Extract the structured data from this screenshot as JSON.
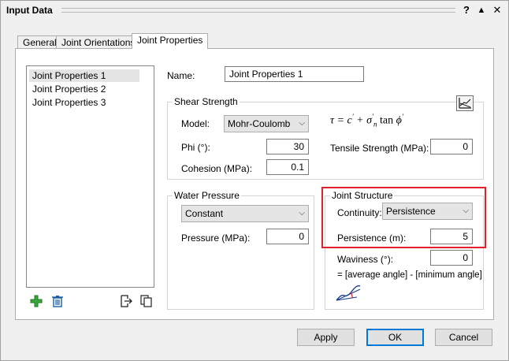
{
  "window": {
    "title": "Input Data",
    "help_label": "?",
    "collapse_label": "▲",
    "close_label": "✕"
  },
  "tabs": [
    {
      "label": "General"
    },
    {
      "label": "Joint Orientations"
    },
    {
      "label": "Joint Properties"
    }
  ],
  "joint_list": {
    "items": [
      "Joint Properties 1",
      "Joint Properties 2",
      "Joint Properties 3"
    ],
    "selected": 0
  },
  "name_field": {
    "label": "Name:",
    "value": "Joint Properties 1"
  },
  "shear_strength": {
    "title": "Shear Strength",
    "model_label": "Model:",
    "model_value": "Mohr-Coulomb",
    "phi_label": "Phi (°):",
    "phi_value": "30",
    "cohesion_label": "Cohesion (MPa):",
    "cohesion_value": "0.1",
    "tensile_label": "Tensile Strength (MPa):",
    "tensile_value": "0"
  },
  "water_pressure": {
    "title": "Water Pressure",
    "type_value": "Constant",
    "pressure_label": "Pressure (MPa):",
    "pressure_value": "0"
  },
  "joint_structure": {
    "title": "Joint Structure",
    "continuity_label": "Continuity:",
    "continuity_value": "Persistence",
    "persistence_label": "Persistence (m):",
    "persistence_value": "5",
    "waviness_label": "Waviness (°):",
    "waviness_value": "0",
    "waviness_note": "= [average angle] - [minimum angle]"
  },
  "buttons": {
    "apply": "Apply",
    "ok": "OK",
    "cancel": "Cancel"
  },
  "colors": {
    "highlight": "#e0202a",
    "add_icon": "#3aa63a",
    "delete_icon": "#1a5fa8",
    "default_button_border": "#0078d7"
  }
}
